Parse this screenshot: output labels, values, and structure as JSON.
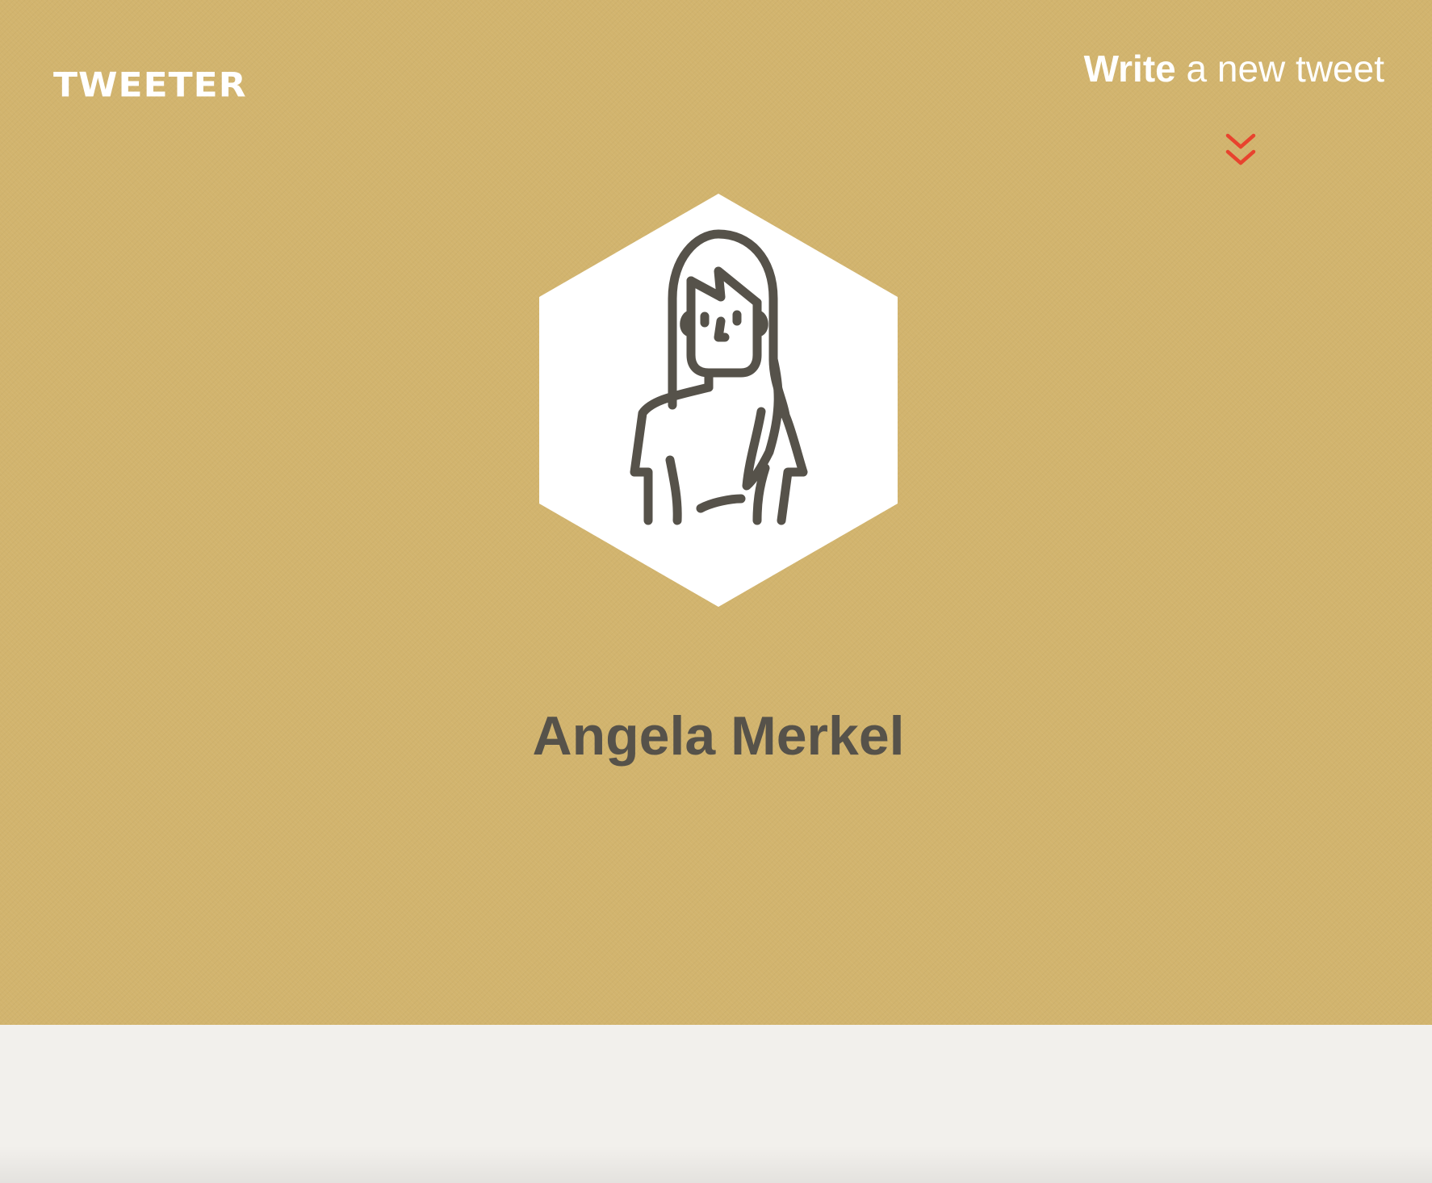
{
  "header": {
    "logo_text": "TWEETER",
    "write_strong": "Write",
    "write_rest": " a new tweet"
  },
  "icons": {
    "chevron": "double-chevron-down-icon",
    "avatar": "woman-avatar-icon"
  },
  "profile": {
    "name": "Angela Merkel"
  },
  "colors": {
    "hero_background": "#d2b46e",
    "content_background": "#f2f0ec",
    "accent": "#e8432e",
    "name_text": "#56524a",
    "icon_stroke": "#56524a"
  }
}
